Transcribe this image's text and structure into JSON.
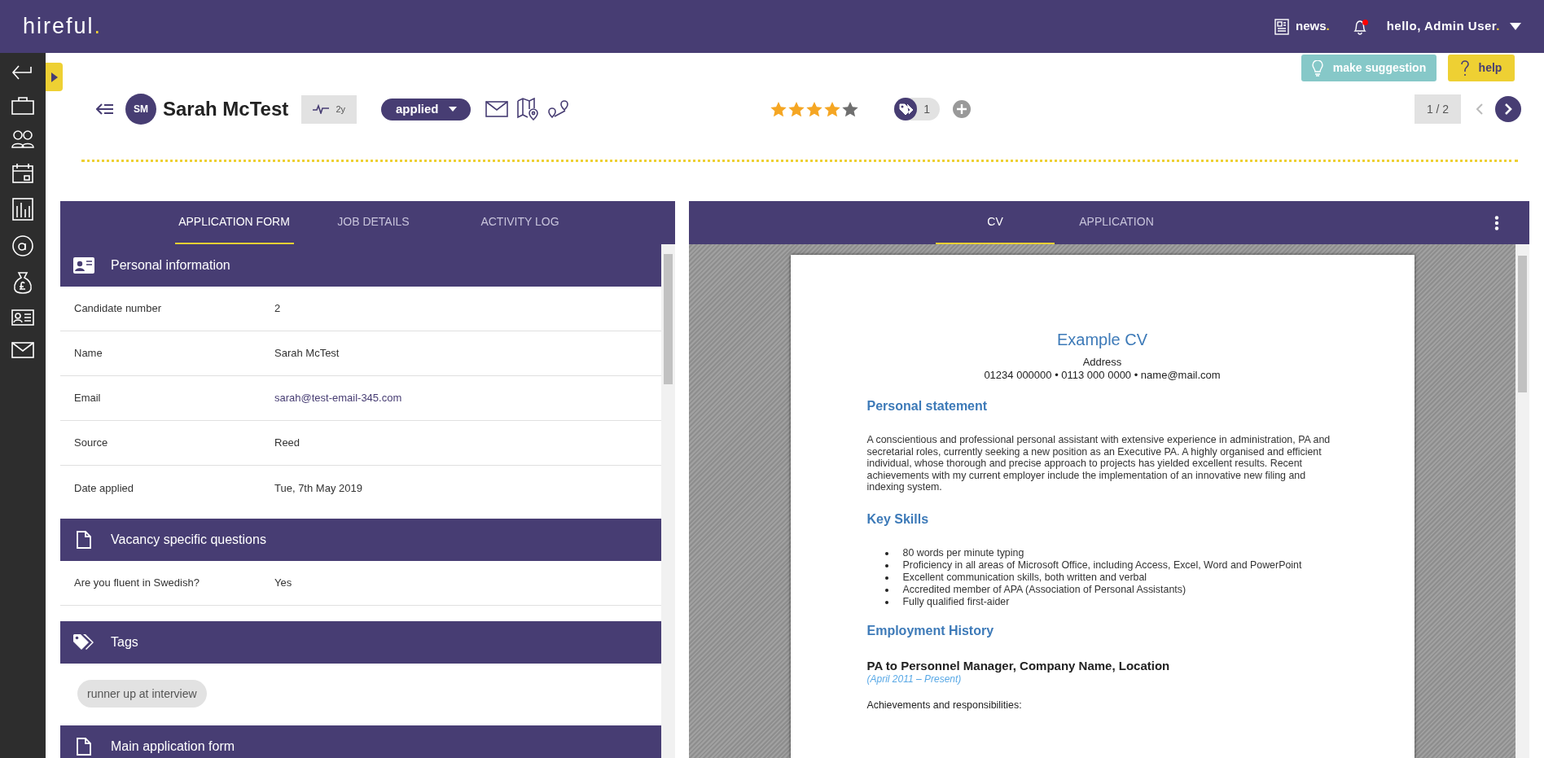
{
  "header": {
    "logo": {
      "text": "hireful",
      "accent": "."
    },
    "news": {
      "text": "news",
      "accent": "."
    },
    "notifications": {
      "unread": true
    },
    "user": {
      "text": "hello, Admin User",
      "accent": "."
    }
  },
  "actions": [
    {
      "kind": "suggestion",
      "label": "make suggestion"
    },
    {
      "kind": "help",
      "label": "help"
    }
  ],
  "candidate": {
    "initials": "SM",
    "name": "Sarah McTest",
    "activity": "2y",
    "status": "applied",
    "stars": 4,
    "tag_count": "1",
    "pager": "1 / 2"
  },
  "left_tabs": [
    {
      "label": "APPLICATION FORM",
      "selected": true
    },
    {
      "label": "JOB DETAILS",
      "selected": false
    },
    {
      "label": "ACTIVITY LOG",
      "selected": false
    }
  ],
  "sections": [
    {
      "kind": "contact",
      "title": "Personal information",
      "rows": [
        {
          "label": "Candidate number",
          "value": "2",
          "link": false
        },
        {
          "label": "Name",
          "value": "Sarah McTest",
          "link": false
        },
        {
          "label": "Email",
          "value": "sarah@test-email-345.com",
          "link": true
        },
        {
          "label": "Source",
          "value": "Reed",
          "link": false
        },
        {
          "label": "Date applied",
          "value": "Tue, 7th May 2019",
          "link": false
        }
      ]
    },
    {
      "kind": "questions",
      "title": "Vacancy specific questions",
      "rows": [
        {
          "label": "Are you fluent in Swedish?",
          "value": "Yes",
          "link": false
        }
      ]
    },
    {
      "kind": "tags",
      "title": "Tags",
      "tags": [
        "runner up at interview"
      ]
    },
    {
      "kind": "form",
      "title": "Main application form"
    }
  ],
  "right_tabs": [
    {
      "label": "CV",
      "selected": true
    },
    {
      "label": "APPLICATION",
      "selected": false
    }
  ],
  "cv": {
    "title": "Example CV",
    "address": "Address",
    "contact": "01234 000000 • 0113 000 0000 • name@mail.com",
    "blocks": [
      {
        "kind": "heading",
        "text": "Personal statement"
      },
      {
        "kind": "paragraph",
        "text": "A conscientious and professional personal assistant with extensive experience in administration, PA and secretarial roles, currently seeking a new position as an Executive PA. A highly organised and efficient individual, whose thorough and precise approach to projects has yielded excellent results. Recent achievements with my current employer include the implementation of an innovative new filing and indexing system."
      },
      {
        "kind": "heading",
        "text": "Key Skills"
      },
      {
        "kind": "bullets",
        "items": [
          "80 words per minute typing",
          "Proficiency in all areas of Microsoft Office, including Access, Excel, Word and PowerPoint",
          "Excellent communication skills, both written and verbal",
          "Accredited member of APA (Association of Personal Assistants)",
          "Fully qualified first-aider"
        ]
      },
      {
        "kind": "heading",
        "text": "Employment History"
      },
      {
        "kind": "job",
        "title": "PA to Personnel Manager, Company Name, Location",
        "dates": "(April 2011 – Present)"
      },
      {
        "kind": "plain",
        "text": "Achievements and responsibilities:"
      }
    ]
  }
}
